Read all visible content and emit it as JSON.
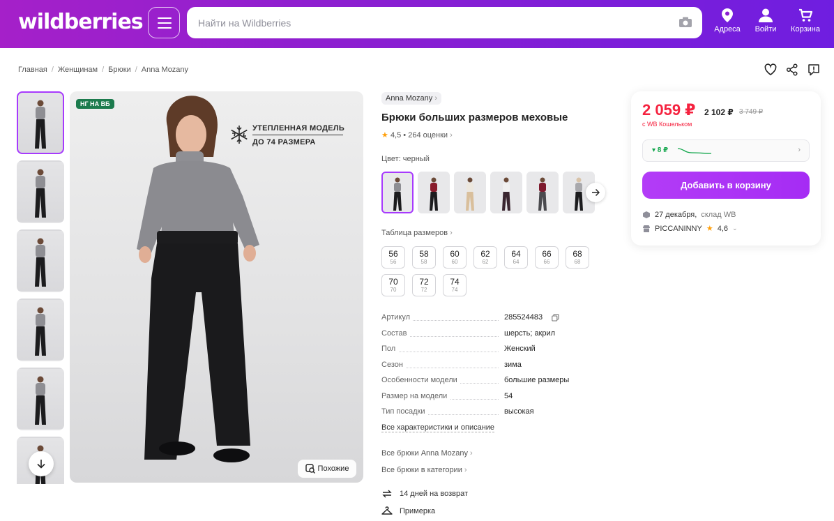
{
  "header": {
    "logo": "wildberries",
    "search_placeholder": "Найти на Wildberries",
    "addresses": "Адреса",
    "login": "Войти",
    "cart": "Корзина"
  },
  "breadcrumb": [
    "Главная",
    "Женщинам",
    "Брюки",
    "Anna Mozany"
  ],
  "gallery": {
    "badge": "НГ НА ВБ",
    "promo_line1": "УТЕПЛЕННАЯ МОДЕЛЬ",
    "promo_line2": "ДО 74 РАЗМЕРА",
    "similar": "Похожие"
  },
  "product": {
    "brand": "Anna Mozany",
    "title": "Брюки больших размеров меховые",
    "rating": "4,5",
    "reviews": "264 оценки",
    "color_label": "Цвет: черный",
    "size_table": "Таблица размеров",
    "sizes": [
      {
        "ru": "56",
        "sub": "56"
      },
      {
        "ru": "58",
        "sub": "58"
      },
      {
        "ru": "60",
        "sub": "60"
      },
      {
        "ru": "62",
        "sub": "62"
      },
      {
        "ru": "64",
        "sub": "64"
      },
      {
        "ru": "66",
        "sub": "66"
      },
      {
        "ru": "68",
        "sub": "68"
      },
      {
        "ru": "70",
        "sub": "70"
      },
      {
        "ru": "72",
        "sub": "72"
      },
      {
        "ru": "74",
        "sub": "74"
      }
    ],
    "specs": [
      {
        "k": "Артикул",
        "v": "285524483"
      },
      {
        "k": "Состав",
        "v": "шерсть; акрил"
      },
      {
        "k": "Пол",
        "v": "Женский"
      },
      {
        "k": "Сезон",
        "v": "зима"
      },
      {
        "k": "Особенности модели",
        "v": "большие размеры"
      },
      {
        "k": "Размер на модели",
        "v": "54"
      },
      {
        "k": "Тип посадки",
        "v": "высокая"
      }
    ],
    "all_chars": "Все характеристики и описание",
    "all_brand": "Все брюки Anna Mozany",
    "all_category": "Все брюки в категории",
    "returns": "14 дней на возврат",
    "fitting": "Примерка"
  },
  "price": {
    "wallet_price": "2 059 ₽",
    "price": "2 102 ₽",
    "old_price": "3 749 ₽",
    "wallet_note": "с WB Кошельком",
    "trend": "▾ 8 ₽",
    "add_to_cart": "Добавить в корзину",
    "delivery_date": "27 декабря,",
    "warehouse": "склад WB",
    "seller": "PICCANINNY",
    "seller_rating": "4,6"
  },
  "colors": {
    "accent": "#a73afd",
    "price_red": "#f5223f",
    "header_start": "#a520c9",
    "header_end": "#6f1ee0"
  }
}
